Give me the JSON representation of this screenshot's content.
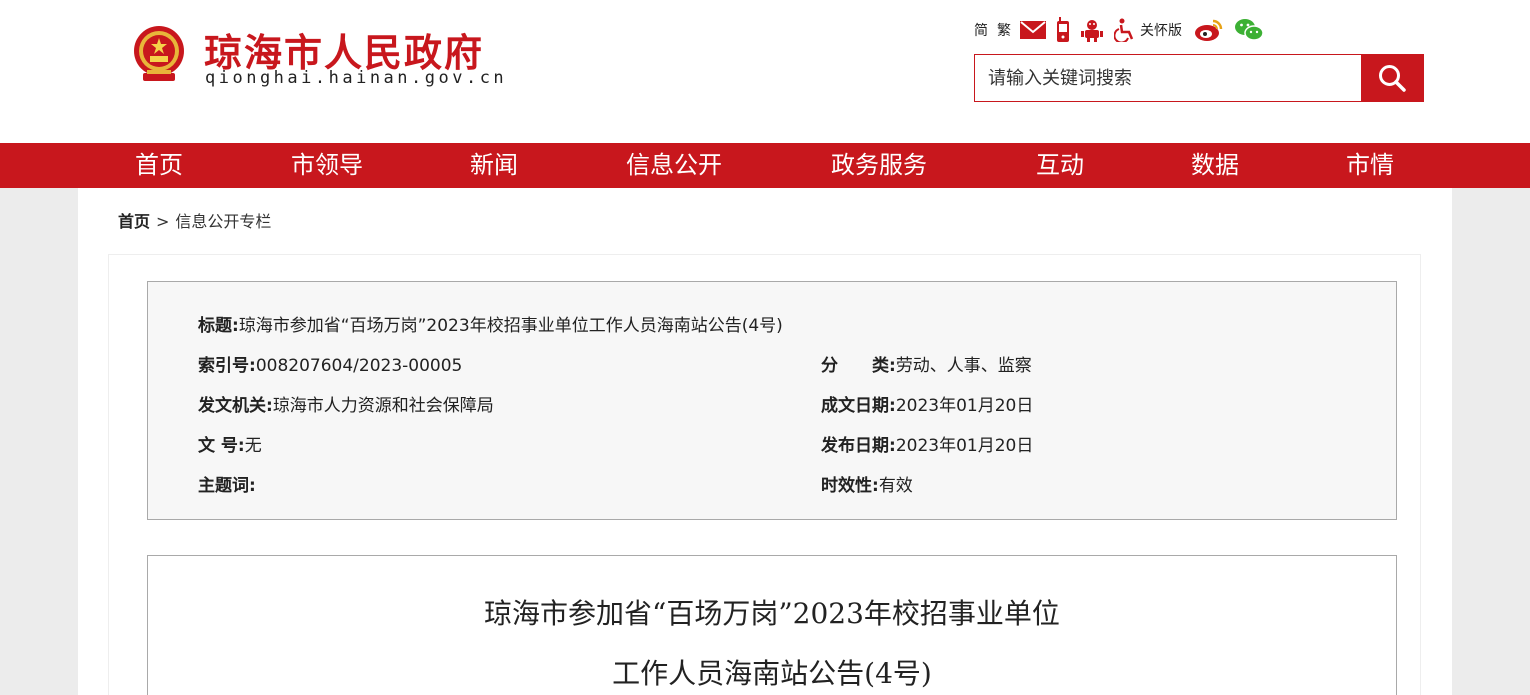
{
  "header": {
    "site_name": "琼海市人民政府",
    "site_domain": "qionghai.hainan.gov.cn",
    "toolbar": {
      "simplified": "简",
      "traditional": "繁",
      "care_version": "关怀版",
      "icons": [
        "mail-icon",
        "mobile-icon",
        "robot-icon",
        "accessibility-icon",
        "weibo-icon",
        "wechat-icon"
      ]
    },
    "search": {
      "placeholder": "请输入关键词搜索"
    }
  },
  "nav": {
    "items": [
      {
        "label": "首页"
      },
      {
        "label": "市领导"
      },
      {
        "label": "新闻"
      },
      {
        "label": "信息公开"
      },
      {
        "label": "政务服务"
      },
      {
        "label": "互动"
      },
      {
        "label": "数据"
      },
      {
        "label": "市情"
      }
    ]
  },
  "breadcrumb": {
    "home": "首页",
    "separator": ">",
    "current": "信息公开专栏"
  },
  "meta": {
    "title_label": "标题:",
    "title_value": "琼海市参加省“百场万岗”2023年校招事业单位工作人员海南站公告(4号)",
    "index_label": "索引号:",
    "index_value": "008207604/2023-00005",
    "category_label": "分　　类:",
    "category_value": "劳动、人事、监察",
    "issuer_label": "发文机关:",
    "issuer_value": "琼海市人力资源和社会保障局",
    "written_label": "成文日期:",
    "written_value": "2023年01月20日",
    "docno_label": "文 号:",
    "docno_value": "无",
    "published_label": "发布日期:",
    "published_value": "2023年01月20日",
    "keywords_label": "主题词:",
    "keywords_value": "",
    "validity_label": "时效性:",
    "validity_value": "有效"
  },
  "article": {
    "title_line1": "琼海市参加省“百场万岗”2023年校招事业单位",
    "title_line2": "工作人员海南站公告(4号)"
  },
  "colors": {
    "brand_red": "#c8171d",
    "meta_bg": "#f7f7f7",
    "page_bg": "#ececec"
  }
}
